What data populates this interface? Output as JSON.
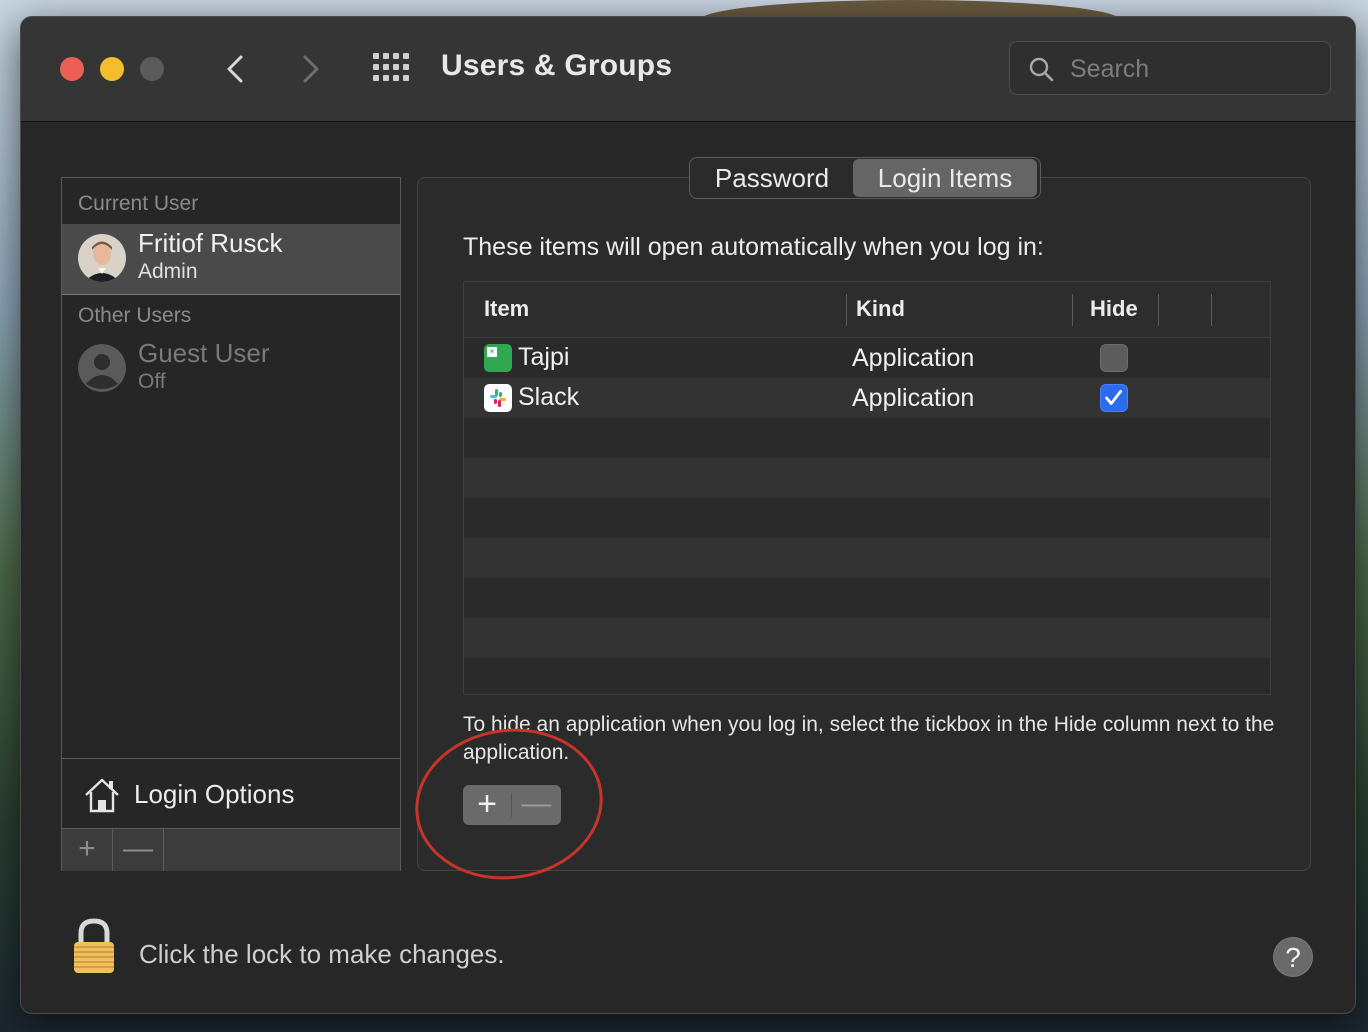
{
  "window": {
    "title": "Users & Groups",
    "search_placeholder": "Search"
  },
  "sidebar": {
    "current_user_header": "Current User",
    "current_user": {
      "name": "Fritiof Rusck",
      "role": "Admin"
    },
    "other_users_header": "Other Users",
    "other_users": [
      {
        "name": "Guest User",
        "role": "Off"
      }
    ],
    "login_options_label": "Login Options",
    "add_label": "+",
    "remove_label": "—"
  },
  "tabs": [
    {
      "label": "Password",
      "selected": false
    },
    {
      "label": "Login Items",
      "selected": true
    }
  ],
  "login_items": {
    "intro": "These items will open automatically when you log in:",
    "columns": [
      "Item",
      "Kind",
      "Hide"
    ],
    "rows": [
      {
        "name": "Tajpi",
        "kind": "Application",
        "hide": false,
        "icon": "tajpi-icon",
        "icon_color": "#2fa84f"
      },
      {
        "name": "Slack",
        "kind": "Application",
        "hide": true,
        "icon": "slack-icon",
        "icon_color": "#ffffff"
      }
    ],
    "hint": "To hide an application when you log in, select the tickbox in the Hide column next to the application.",
    "add_label": "+",
    "remove_label": "—"
  },
  "footer": {
    "lock_text": "Click the lock to make changes.",
    "help_label": "?"
  },
  "colors": {
    "accent": "#2a6bf0",
    "annotation_circle": "#c8342a",
    "close": "#ec5f57",
    "minimize": "#f4bd2e"
  }
}
